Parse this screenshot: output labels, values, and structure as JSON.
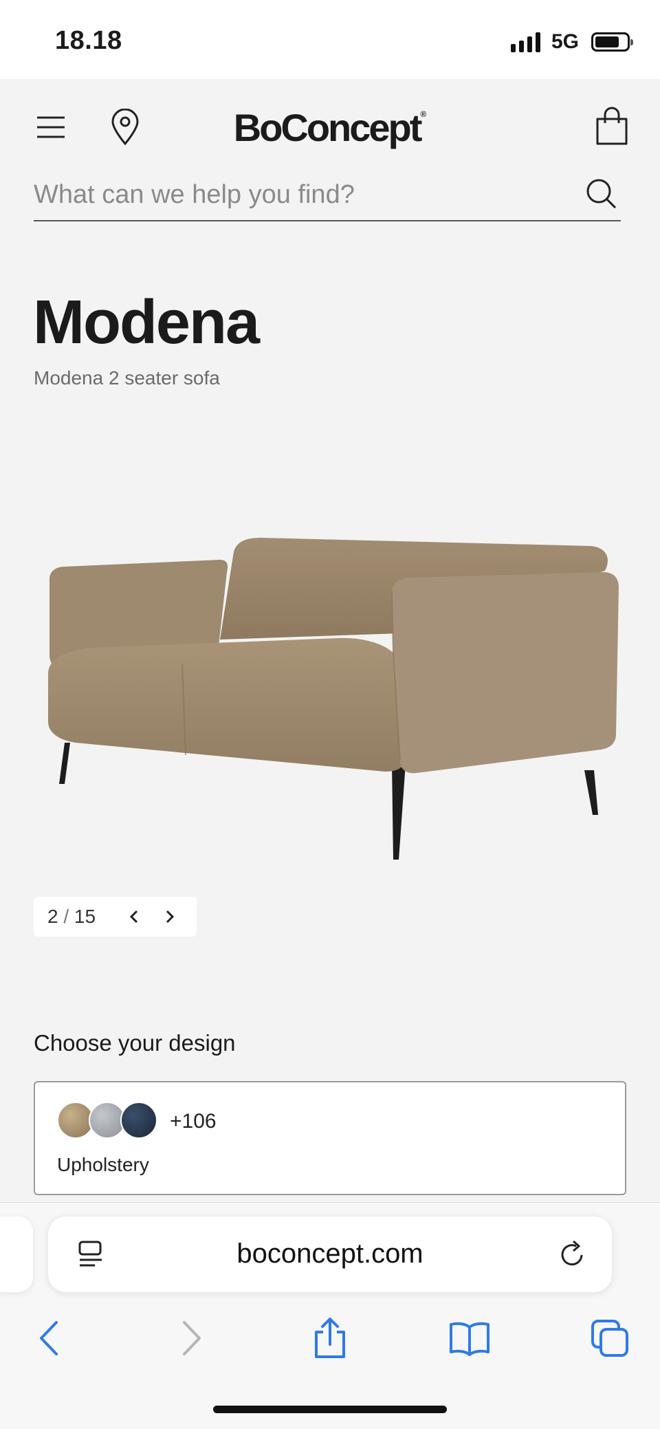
{
  "status_bar": {
    "time": "18.18",
    "network": "5G"
  },
  "header": {
    "logo": "BoConcept",
    "logo_mark": "®",
    "icons": [
      "menu-icon",
      "location-pin-icon",
      "shopping-bag-icon"
    ]
  },
  "search": {
    "placeholder": "What can we help you find?",
    "icon": "search-icon"
  },
  "product": {
    "title": "Modena",
    "subtitle": "Modena 2 seater sofa",
    "image_color": "#a08b72"
  },
  "gallery": {
    "current": "2",
    "separator": "/",
    "total": "15"
  },
  "design": {
    "heading": "Choose your design",
    "swatch_more": "+106",
    "label": "Upholstery",
    "swatch_colors": [
      "#a8916c",
      "#a9adb3",
      "#26354c"
    ]
  },
  "browser": {
    "url": "boconcept.com",
    "accent": "#2f7ae5",
    "toolbar_icons": [
      "back-icon",
      "forward-icon",
      "share-icon",
      "bookmarks-icon",
      "tabs-icon"
    ]
  }
}
